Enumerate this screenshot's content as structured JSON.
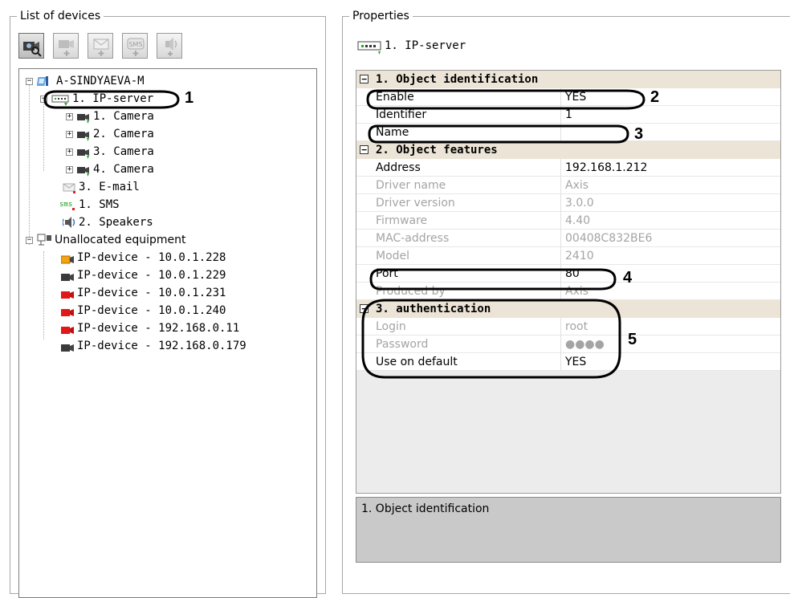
{
  "left_panel": {
    "title": "List of devices",
    "toolbar": [
      {
        "name": "search-devices-button",
        "icon": "camera-search-icon"
      },
      {
        "name": "add-camera-button",
        "icon": "camera-add-icon"
      },
      {
        "name": "add-email-button",
        "icon": "email-add-icon"
      },
      {
        "name": "add-sms-button",
        "icon": "sms-add-icon"
      },
      {
        "name": "add-speaker-button",
        "icon": "speaker-add-icon"
      }
    ],
    "tree": {
      "root": "A-SINDYAEVA-M",
      "ip_server": "1. IP-server",
      "cameras": [
        "1. Camera",
        "2. Camera",
        "3. Camera",
        "4. Camera"
      ],
      "email": "3. E-mail",
      "sms": "1. SMS",
      "speakers": "2. Speakers",
      "unallocated": "Unallocated equipment",
      "devices": [
        "IP-device - 10.0.1.228",
        "IP-device - 10.0.1.229",
        "IP-device - 10.0.1.231",
        "IP-device - 10.0.1.240",
        "IP-device - 192.168.0.11",
        "IP-device - 192.168.0.179"
      ]
    }
  },
  "right_panel": {
    "title": "Properties",
    "selected_object": "1. IP-server",
    "categories": [
      {
        "label": "1. Object identification",
        "toggle": "⊟",
        "props": [
          {
            "name": "Enable",
            "value": "YES",
            "readonly": false
          },
          {
            "name": "Identifier",
            "value": "1",
            "readonly": false
          },
          {
            "name": "Name",
            "value": "",
            "readonly": false
          }
        ]
      },
      {
        "label": "2. Object features",
        "toggle": "⊟",
        "props": [
          {
            "name": "Address",
            "value": "192.168.1.212",
            "readonly": false
          },
          {
            "name": "Driver name",
            "value": "Axis",
            "readonly": true
          },
          {
            "name": "Driver version",
            "value": "3.0.0",
            "readonly": true
          },
          {
            "name": "Firmware",
            "value": "4.40",
            "readonly": true
          },
          {
            "name": "MAC-address",
            "value": "00408C832BE6",
            "readonly": true
          },
          {
            "name": "Model",
            "value": "2410",
            "readonly": true
          },
          {
            "name": "Port",
            "value": "80",
            "readonly": false
          },
          {
            "name": "Produced by",
            "value": "Axis",
            "readonly": true
          }
        ]
      },
      {
        "label": "3. authentication",
        "toggle": "⊟",
        "props": [
          {
            "name": "Login",
            "value": "root",
            "readonly": true
          },
          {
            "name": "Password",
            "value": "●●●●",
            "readonly": true
          },
          {
            "name": "Use on default",
            "value": "YES",
            "readonly": false
          }
        ]
      }
    ],
    "description": "1. Object identification"
  },
  "annotations": [
    "1",
    "2",
    "3",
    "4",
    "5"
  ],
  "colors": {
    "category_bg": "#ece4d6",
    "description_bg": "#c9c9c9",
    "readonly_text": "#a4a4a4",
    "border": "#a7a7a7"
  }
}
